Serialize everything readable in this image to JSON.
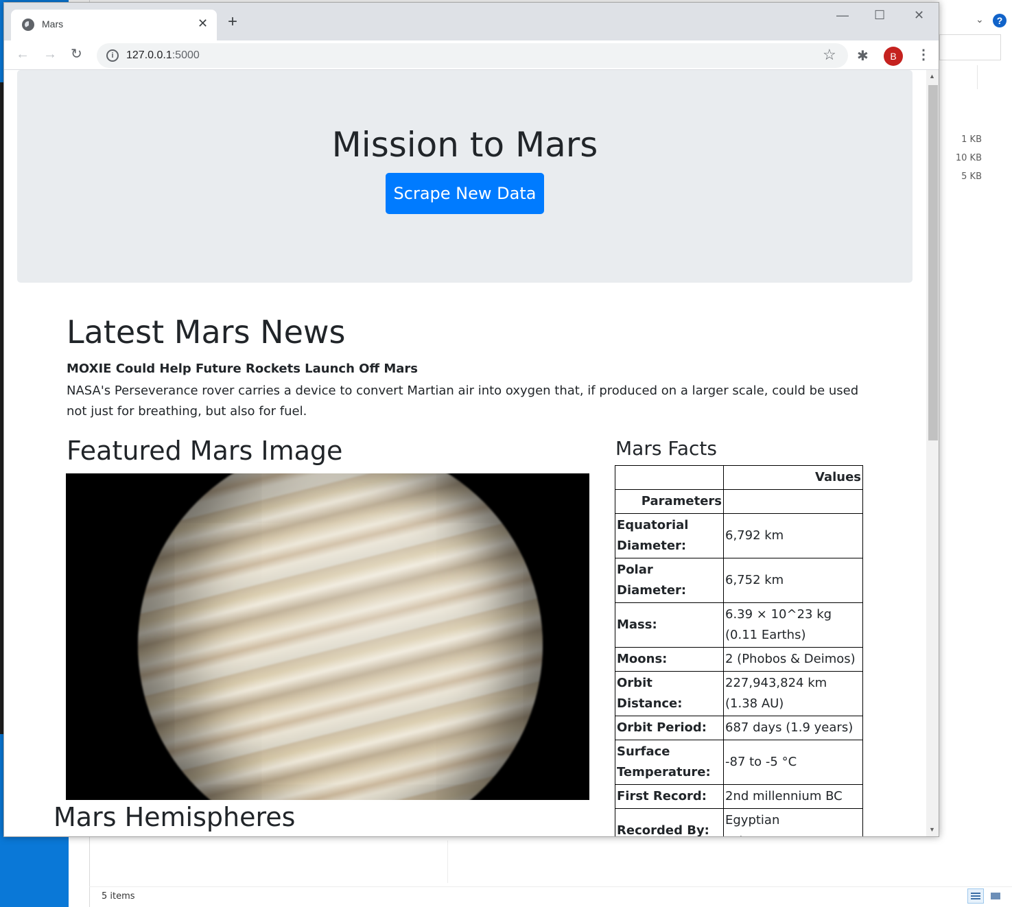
{
  "browser": {
    "tab_title": "Mars",
    "url_host": "127.0.0.1",
    "url_port": ":5000",
    "profile_initial": "B"
  },
  "explorer": {
    "file_sizes": [
      "1 KB",
      "10 KB",
      "5 KB"
    ],
    "status_text": "5 items",
    "help_label": "?"
  },
  "page": {
    "title": "Mission to Mars",
    "scrape_button_label": "Scrape New Data",
    "news": {
      "heading": "Latest Mars News",
      "title": "MOXIE Could Help Future Rockets Launch Off Mars",
      "paragraph": "NASA's Perseverance rover carries a device to convert Martian air into oxygen that, if produced on a larger scale, could be used not just for breathing, but also for fuel."
    },
    "featured": {
      "heading": "Featured Mars Image"
    },
    "facts": {
      "heading": "Mars Facts",
      "column_header": "Values",
      "index_header": "Parameters",
      "rows": [
        {
          "param": "Equatorial Diameter:",
          "value": "6,792 km"
        },
        {
          "param": "Polar Diameter:",
          "value": "6,752 km"
        },
        {
          "param": "Mass:",
          "value": "6.39 × 10^23 kg (0.11 Earths)"
        },
        {
          "param": "Moons:",
          "value": "2 (Phobos & Deimos)"
        },
        {
          "param": "Orbit Distance:",
          "value": "227,943,824 km (1.38 AU)"
        },
        {
          "param": "Orbit Period:",
          "value": "687 days (1.9 years)"
        },
        {
          "param": "Surface Temperature:",
          "value": "-87 to -5 °C"
        },
        {
          "param": "First Record:",
          "value": "2nd millennium BC"
        },
        {
          "param": "Recorded By:",
          "value": "Egyptian astronomers"
        }
      ]
    },
    "hemispheres": {
      "heading": "Mars Hemispheres"
    }
  },
  "colors": {
    "primary_button": "#007bff",
    "jumbotron_bg": "#e9ecef",
    "avatar_bg": "#c5221f"
  }
}
